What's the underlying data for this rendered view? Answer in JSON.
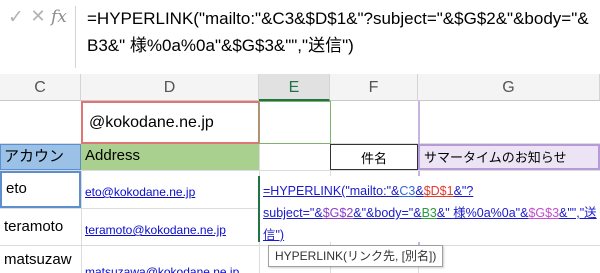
{
  "formula_bar": {
    "cancel_icon": "✕",
    "enter_icon": "✓",
    "fx_label": "fx",
    "formula": "=HYPERLINK(\"mailto:\"&C3&$D$1&\"?subject=\"&$G$2&\"&body=\"&B3&\" 様%0a%0a\"&$G$3&\"\",\"送信\")"
  },
  "columns": [
    "C",
    "D",
    "E",
    "F",
    "G"
  ],
  "selected_column": "E",
  "cells": {
    "D1": "@kokodane.ne.jp",
    "C2": "アカウン",
    "D2": "Address",
    "F2": "件名",
    "G2": "サマータイムのお知らせ",
    "C3": "eto",
    "D3": "eto@kokodane.ne.jp",
    "C4": "teramoto",
    "D4": "teramoto@kokodane.ne.jp",
    "C5": "matsuzaw",
    "D5": "matsuzawa@kokodane.ne.jp"
  },
  "in_cell_edit": {
    "parts": [
      "=HYPERLINK(\"mailto:\"&",
      "C3",
      "&",
      "$D$1",
      "&\"?subject=\"&",
      "$G$2",
      "&\"&body=\"&",
      "B3",
      "&\" 様%0a%0a\"&",
      "$G$3",
      "&\"\",\"送信\")"
    ]
  },
  "tooltip": "HYPERLINK(リンク先, [別名])",
  "colors": {
    "header_green": "#a9d08e",
    "account_blue": "#9bc2e6",
    "subject_purple": "#ece4f5",
    "selection_green": "#217346",
    "link_blue": "#0b0bcc"
  }
}
